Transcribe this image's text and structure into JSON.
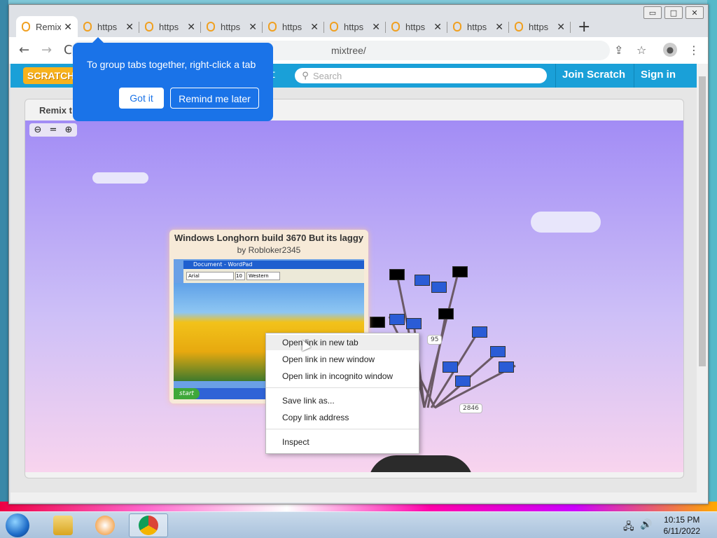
{
  "window": {
    "minimize": "▭",
    "maximize": "□",
    "close": "✕"
  },
  "tabs": [
    {
      "title": "Remix",
      "active": true
    },
    {
      "title": "https",
      "active": false
    },
    {
      "title": "https",
      "active": false
    },
    {
      "title": "https",
      "active": false
    },
    {
      "title": "https",
      "active": false
    },
    {
      "title": "https",
      "active": false
    },
    {
      "title": "https",
      "active": false
    },
    {
      "title": "https",
      "active": false
    },
    {
      "title": "https",
      "active": false
    }
  ],
  "new_tab": "+",
  "toolbar": {
    "url_fragment": "mixtree/",
    "back": "←",
    "forward": "→",
    "reload": "C",
    "share": "⇪",
    "star": "☆",
    "menu": "⋮"
  },
  "scratch": {
    "logo": "SCRATCH",
    "nav_partial": "t",
    "search_placeholder": "Search",
    "join": "Join Scratch",
    "signin": "Sign in"
  },
  "remix": {
    "title": "Remix t",
    "zoom_out": "🔍-",
    "zoom_reset": "=",
    "zoom_in": "🔍+"
  },
  "project": {
    "title": "Windows Longhorn build 3670 But its laggy",
    "author": "by Robloker2345",
    "thumb_window": "Document - WordPad",
    "font_name": "Arial",
    "font_size": "10",
    "script": "Western",
    "start": "start"
  },
  "tree_labels": {
    "count_95": "95",
    "count_2846": "2846"
  },
  "context_menu": [
    {
      "label": "Open link in new tab",
      "hover": true
    },
    {
      "label": "Open link in new window",
      "hover": false
    },
    {
      "label": "Open link in incognito window",
      "hover": false
    },
    {
      "label": "Save link as...",
      "hover": false
    },
    {
      "label": "Copy link address",
      "hover": false
    },
    {
      "label": "Inspect",
      "hover": false
    }
  ],
  "popup": {
    "message": "To group tabs together, right-click a tab",
    "got_it": "Got it",
    "remind": "Remind me later"
  },
  "taskbar": {
    "time": "10:15 PM",
    "date": "6/11/2022"
  },
  "colors": {
    "chrome_blue": "#1a73e8",
    "scratch_blue": "#1aa0d8"
  }
}
